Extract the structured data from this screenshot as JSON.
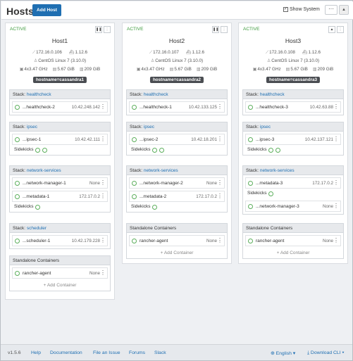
{
  "header": {
    "title": "Hosts",
    "add_host": "Add Host",
    "show_system": "Show System",
    "more": "···"
  },
  "hosts": [
    {
      "state": "ACTIVE",
      "name": "Host1",
      "ip": "172.16.0.106",
      "docker": "1.12.6",
      "os": "CentOS Linux 7 (3.10.0)",
      "cpu": "4x3.47 GHz",
      "ram": "5.67 GiB",
      "disk": "209 GiB",
      "label": "hostname=cassandra1",
      "stacks": [
        {
          "prefix": "Stack: ",
          "name": "healthcheck",
          "containers": [
            {
              "name": "...healthcheck-2",
              "ip": "10.42.248.142"
            }
          ]
        },
        {
          "prefix": "Stack: ",
          "name": "ipsec",
          "containers": [
            {
              "name": "...ipsec-1",
              "ip": "10.42.42.111"
            }
          ],
          "sidekicks": "Sidekicks"
        },
        {
          "prefix": "Stack: ",
          "name": "network-services",
          "containers": [
            {
              "name": "...network-manager-1",
              "ip": "None"
            },
            {
              "name": "...metadata-1",
              "ip": "172.17.0.2"
            }
          ],
          "sidekicks": "Sidekicks"
        },
        {
          "prefix": "Stack: ",
          "name": "scheduler",
          "containers": [
            {
              "name": "...scheduler-1",
              "ip": "10.42.179.228"
            }
          ]
        },
        {
          "prefix": "",
          "name": "Standalone Containers",
          "containers": [
            {
              "name": "rancher-agent",
              "ip": "None"
            }
          ],
          "add": "Add Container"
        }
      ]
    },
    {
      "state": "ACTIVE",
      "name": "Host2",
      "ip": "172.16.0.107",
      "docker": "1.12.6",
      "os": "CentOS Linux 7 (3.10.0)",
      "cpu": "4x3.47 GHz",
      "ram": "5.67 GiB",
      "disk": "209 GiB",
      "label": "hostname=cassandra2",
      "stacks": [
        {
          "prefix": "Stack: ",
          "name": "healthcheck",
          "containers": [
            {
              "name": "...healthcheck-1",
              "ip": "10.42.133.125"
            }
          ]
        },
        {
          "prefix": "Stack: ",
          "name": "ipsec",
          "containers": [
            {
              "name": "...ipsec-2",
              "ip": "10.42.18.201"
            }
          ],
          "sidekicks": "Sidekicks"
        },
        {
          "prefix": "Stack: ",
          "name": "network-services",
          "containers": [
            {
              "name": "...network-manager-2",
              "ip": "None"
            },
            {
              "name": "...metadata-2",
              "ip": "172.17.0.2"
            }
          ],
          "sidekicks": "Sidekicks"
        },
        {
          "prefix": "",
          "name": "Standalone Containers",
          "containers": [
            {
              "name": "rancher-agent",
              "ip": "None"
            }
          ],
          "add": "Add Container"
        }
      ]
    },
    {
      "state": "ACTIVE",
      "name": "Host3",
      "ip": "172.16.0.108",
      "docker": "1.12.6",
      "os": "CentOS Linux 7 (3.10.0)",
      "cpu": "4x3.47 GHz",
      "ram": "5.67 GiB",
      "disk": "209 GiB",
      "label": "hostname=cassandra3",
      "stacks": [
        {
          "prefix": "Stack: ",
          "name": "healthcheck",
          "containers": [
            {
              "name": "...healthcheck-3",
              "ip": "10.42.63.88"
            }
          ]
        },
        {
          "prefix": "Stack: ",
          "name": "ipsec",
          "containers": [
            {
              "name": "...ipsec-3",
              "ip": "10.42.137.121"
            }
          ],
          "sidekicks": "Sidekicks"
        },
        {
          "prefix": "Stack: ",
          "name": "network-services",
          "containers": [
            {
              "name": "...metadata-3",
              "ip": "172.17.0.2"
            },
            {
              "name": "...network-manager-3",
              "ip": "None"
            }
          ],
          "sidekicks": "Sidekicks",
          "sidekicks_after": 1
        },
        {
          "prefix": "",
          "name": "Standalone Containers",
          "containers": [
            {
              "name": "rancher-agent",
              "ip": "None"
            }
          ],
          "add": "Add Container"
        }
      ]
    }
  ],
  "footer": {
    "version": "v1.5.6",
    "help": "Help",
    "documentation": "Documentation",
    "file_issue": "File an Issue",
    "forums": "Forums",
    "slack": "Slack",
    "language": "English",
    "download_cli": "Download CLI"
  }
}
